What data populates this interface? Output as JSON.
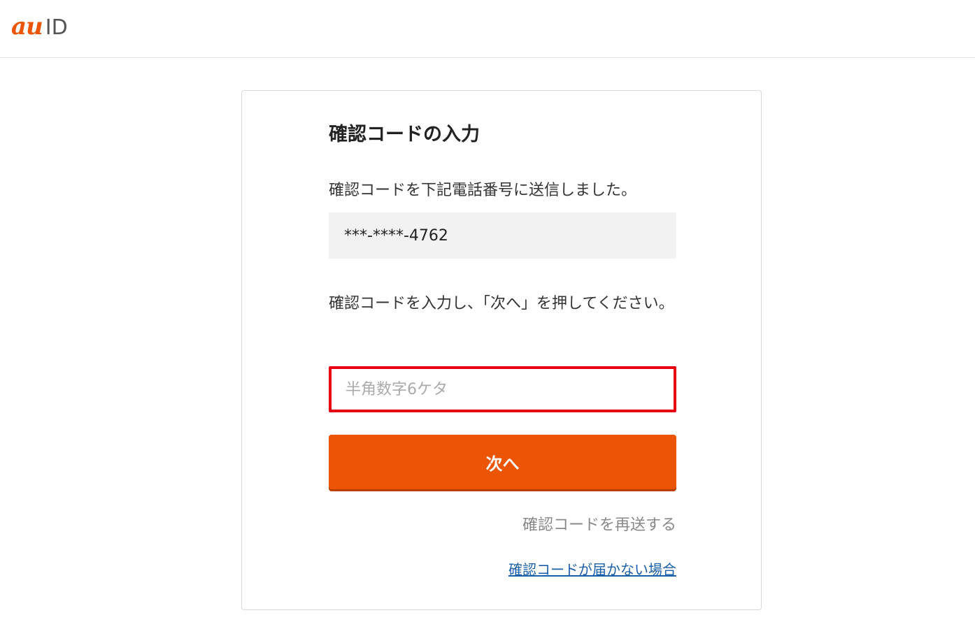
{
  "header": {
    "logo_brand": "au",
    "logo_suffix": "ID",
    "brand_color": "#eb5505"
  },
  "card": {
    "title": "確認コードの入力",
    "sent_message": "確認コードを下記電話番号に送信しました。",
    "masked_phone": "***-****-4762",
    "instruction": "確認コードを入力し、「次へ」を押してください。",
    "code_input": {
      "value": "",
      "placeholder": "半角数字6ケタ",
      "highlight_color": "#e60012"
    },
    "next_button_label": "次へ",
    "resend_link": "確認コードを再送する",
    "not_received_link": "確認コードが届かない場合"
  }
}
